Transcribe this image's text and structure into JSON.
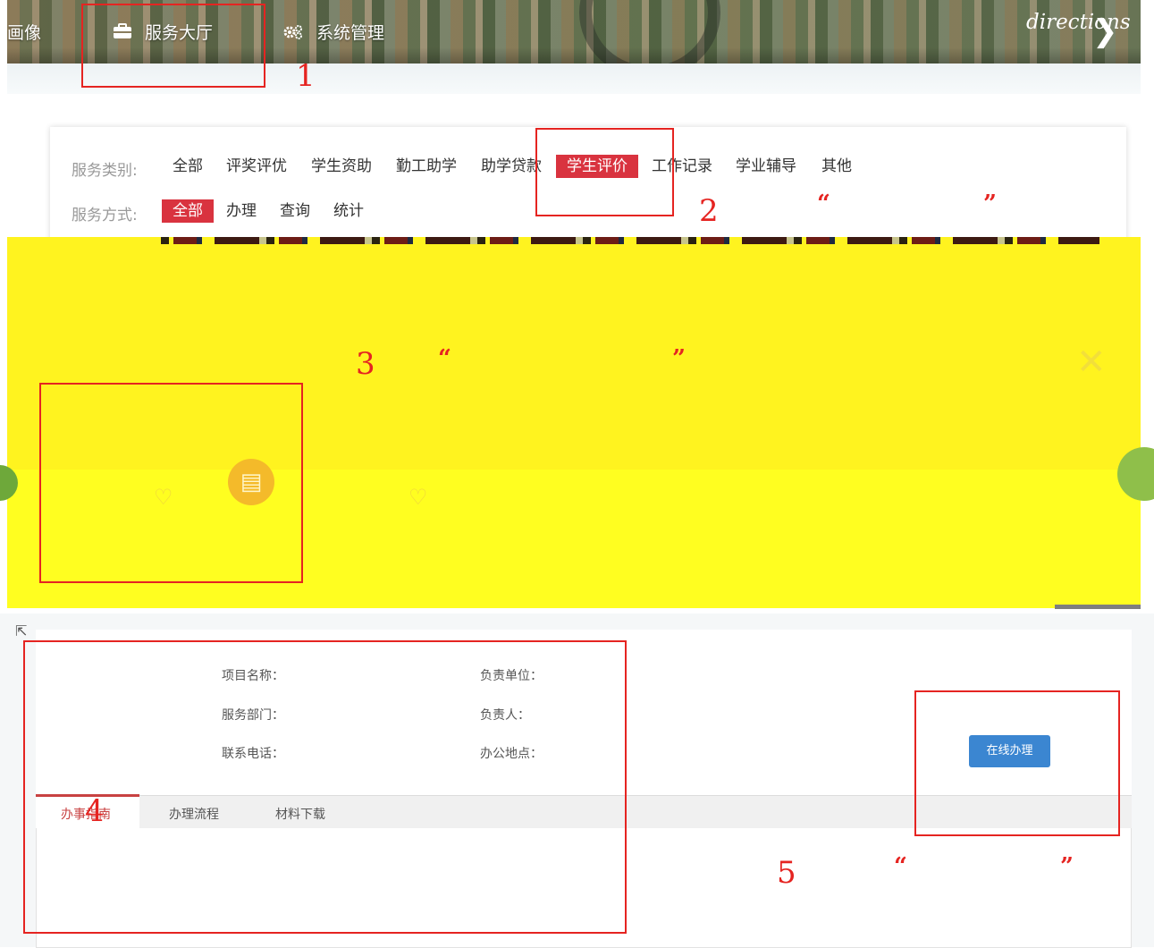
{
  "header": {
    "nav_partial": "画像",
    "nav_service_hall": "服务大厅",
    "nav_system_admin": "系统管理",
    "directions": "directions",
    "chevron": "❯"
  },
  "filter": {
    "category_label": "服务类别:",
    "categories": [
      "全部",
      "评奖评优",
      "学生资助",
      "勤工助学",
      "助学贷款",
      "学生评价",
      "工作记录",
      "学业辅导",
      "其他"
    ],
    "category_active": "学生评价",
    "method_label": "服务方式:",
    "methods": [
      "全部",
      "办理",
      "查询",
      "统计"
    ],
    "method_active": "全部"
  },
  "detail": {
    "project_name": "项目名称：",
    "service_dept": "服务部门：",
    "phone": "联系电话：",
    "responsible_unit": "负责单位：",
    "responsible_person": "负责人：",
    "office": "办公地点：",
    "online_button": "在线办理",
    "tabs": [
      "办事指南",
      "办理流程",
      "材料下载"
    ]
  },
  "annotations": {
    "n1": "1",
    "n2": "2",
    "n3": "3",
    "n4": "4",
    "n5": "5",
    "open_quote": "“",
    "close_quote": "”"
  },
  "colors": {
    "accent_red": "#d9333f",
    "annotation_red": "#e52421",
    "highlight_yellow": "#fff31f",
    "button_blue": "#3b86d1"
  },
  "icons": {
    "briefcase": "briefcase-icon",
    "gears": "gears-icon",
    "pdf": "pdf-document-icon",
    "heart": "heart-icon"
  }
}
